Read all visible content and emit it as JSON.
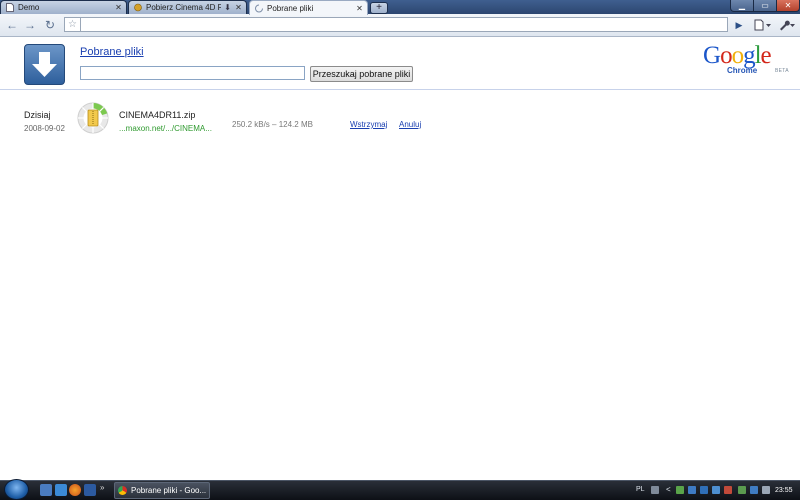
{
  "tabs": [
    {
      "title": "Demo",
      "icon": "page-icon",
      "active": false
    },
    {
      "title": "Pobierz Cinema 4D R1...",
      "icon": "maxon-favicon",
      "active": false,
      "downloading": true
    },
    {
      "title": "Pobrane pliki",
      "icon": "loading-spinner-icon",
      "active": true
    }
  ],
  "new_tab_label": "+",
  "toolbar": {
    "address_value": "",
    "back_icon": "back-arrow-icon",
    "forward_icon": "forward-arrow-icon",
    "reload_icon": "reload-icon",
    "star_icon": "star-icon",
    "go_icon": "go-arrow-icon",
    "page_menu_icon": "page-menu-icon",
    "tools_menu_icon": "wrench-icon"
  },
  "header": {
    "title": "Pobrane pliki",
    "search_value": "",
    "search_button_label": "Przeszukaj pobrane pliki",
    "logo_text": "Google",
    "logo_subtitle": "Chrome",
    "logo_badge": "BETA",
    "icon": "download-arrow-icon"
  },
  "downloads": [
    {
      "day": "Dzisiaj",
      "date": "2008-09-02",
      "file_name": "CINEMA4DR11.zip",
      "url": "...maxon.net/.../CINEMA...",
      "progress_text": "250.2 kB/s – 124.2 MB",
      "pause_label": "Wstrzymaj",
      "cancel_label": "Anuluj",
      "progress_fraction": 0.2
    }
  ],
  "taskbar": {
    "task_button_label": "Pobrane pliki - Goo...",
    "language": "PL",
    "clock": "23:55"
  },
  "colors": {
    "link": "#1a3fb0",
    "url_green": "#2f9a2f",
    "accent_blue": "#2e5f9c"
  }
}
